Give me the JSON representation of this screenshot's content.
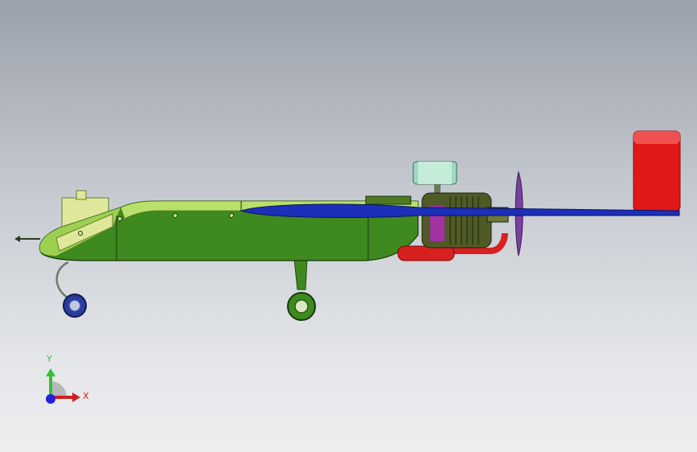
{
  "view": {
    "type": "3d-cad-viewport",
    "background_top": "#9aa1ab",
    "background_bottom": "#eceef0"
  },
  "model": {
    "subject": "uav-airframe-side-view",
    "colors": {
      "fuselage": "#3f8a1f",
      "fuselage_highlight": "#b9e06a",
      "canopy": "#dfe89a",
      "tail_boom": "#1c2fb8",
      "vertical_stabilizer": "#e01818",
      "exhaust": "#d82020",
      "engine": "#4f5a26",
      "engine_accent": "#b02cb8",
      "propeller": "#7a3fa0",
      "air_filter": "#9fd8c0",
      "wheels": "#2a3d9c"
    }
  },
  "triad": {
    "x_label": "X",
    "y_label": "Y",
    "x_color": "#d02020",
    "y_color": "#35c035",
    "z_color": "#2222dd"
  }
}
